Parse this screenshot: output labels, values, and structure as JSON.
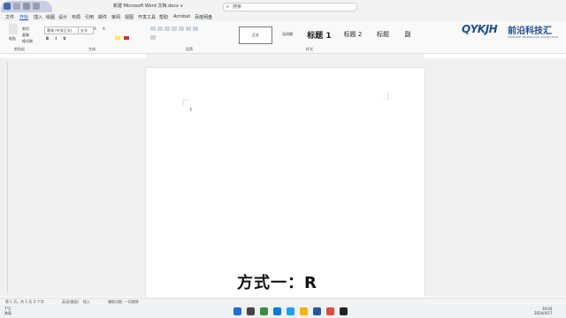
{
  "window": {
    "title": "新建 Microsoft Word 文档.docx ∨",
    "search_placeholder": "搜索"
  },
  "menu": {
    "items": [
      "文件",
      "开始",
      "插入",
      "绘图",
      "设计",
      "布局",
      "引用",
      "邮件",
      "审阅",
      "视图",
      "开发工具",
      "帮助",
      "Acrobat",
      "百度网盘"
    ],
    "active": "开始"
  },
  "ribbon": {
    "clipboard": {
      "paste": "粘贴",
      "cut": "剪切",
      "copy": "复制",
      "format_painter": "格式刷",
      "group": "剪贴板"
    },
    "font": {
      "name": "等线 (中文正文)",
      "size": "五号",
      "group": "字体"
    },
    "paragraph": {
      "group": "段落"
    },
    "styles": {
      "items": [
        "正文",
        "无间隔",
        "标题 1",
        "标题 2",
        "标题",
        "副"
      ],
      "group": "样式"
    }
  },
  "brand": {
    "logo": "QYKJH",
    "name_cn": "前沿科技汇",
    "tagline": "FRONTIER TECHNOLOGY COLLECTION"
  },
  "document": {
    "cursor": "I"
  },
  "subtitle": "方式一：R",
  "status": {
    "page": "第 1 页，共 1 页",
    "words": "0 个字",
    "language": "英语(美国)",
    "insert": "插入",
    "accessibility": "辅助功能: 一切就绪"
  },
  "taskbar": {
    "weather_temp": "7°C",
    "weather_desc": "阵雨",
    "time": "10:02",
    "date": "2024/4/17"
  },
  "colors": {
    "word_blue": "#2b579a",
    "brand_blue": "#1f4f91",
    "accent": "#185abd"
  }
}
